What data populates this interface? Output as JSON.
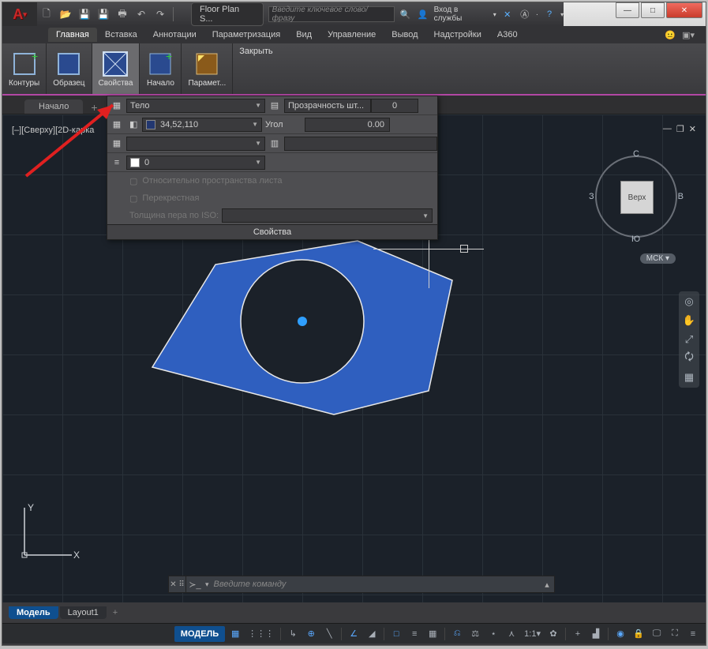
{
  "window": {
    "doc_title": "Floor Plan S...",
    "search_placeholder": "Введите ключевое слово/фразу",
    "login_label": "Вход в службы",
    "min": "—",
    "max": "□",
    "close": "✕"
  },
  "menu": {
    "tabs": [
      "Главная",
      "Вставка",
      "Аннотации",
      "Параметризация",
      "Вид",
      "Управление",
      "Вывод",
      "Надстройки",
      "A360"
    ],
    "active_index": 0
  },
  "ribbon": {
    "panels": [
      {
        "label": "Контуры"
      },
      {
        "label": "Образец"
      },
      {
        "label": "Свойства"
      },
      {
        "label": "Начало"
      },
      {
        "label": "Парамет..."
      }
    ],
    "selected_index": 2,
    "close_label": "Закрыть"
  },
  "file_tabs": {
    "start": "Начало"
  },
  "viewport": {
    "label": "[–][Сверху][2D-карка",
    "cube_face": "Верх",
    "dir_n": "С",
    "dir_s": "Ю",
    "dir_e": "В",
    "dir_w": "З",
    "wcs": "МСК"
  },
  "props": {
    "body": "Тело",
    "color_val": "34,52,110",
    "transp_label": "Прозрачность шт...",
    "transp_val": "0",
    "angle_label": "Угол",
    "angle_val": "0.00",
    "lineweight_val": "0",
    "rel_paper": "Относительно пространства листа",
    "cross": "Перекрестная",
    "pen_iso": "Толщина пера по ISO:",
    "footer": "Свойства"
  },
  "ucs": {
    "x": "X",
    "y": "Y"
  },
  "cmd": {
    "placeholder": "Введите команду"
  },
  "ml_tabs": {
    "model": "Модель",
    "layout1": "Layout1"
  },
  "status": {
    "model": "МОДЕЛЬ",
    "scale": "1:1"
  }
}
